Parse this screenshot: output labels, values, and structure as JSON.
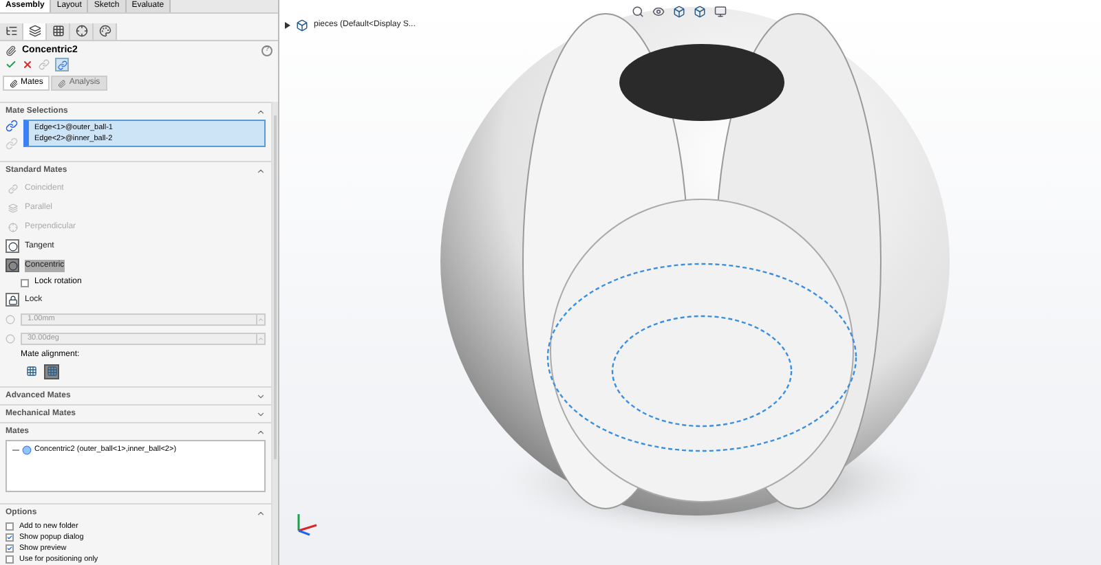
{
  "command_tabs": [
    {
      "label": "Assembly",
      "selected": true
    },
    {
      "label": "Layout",
      "selected": false
    },
    {
      "label": "Sketch",
      "selected": false
    },
    {
      "label": "Evaluate",
      "selected": false
    }
  ],
  "manager_tabs": [
    {
      "selected": false
    },
    {
      "selected": true
    },
    {
      "selected": false
    },
    {
      "selected": false
    },
    {
      "selected": false
    }
  ],
  "feature_title": "Concentric2",
  "help_icon": "?",
  "panel_tabs": [
    {
      "label": "Mates",
      "selected": true
    },
    {
      "label": "Analysis",
      "selected": false
    }
  ],
  "mate_selections": {
    "title": "Mate Selections",
    "items": [
      "Edge<1>@outer_ball-1",
      "Edge<2>@inner_ball-2"
    ]
  },
  "standard_mates": {
    "title": "Standard Mates",
    "items": [
      {
        "kind": "mate",
        "label": "Coincident",
        "selected": false,
        "disabled": true
      },
      {
        "kind": "mate",
        "label": "Parallel",
        "selected": false,
        "disabled": true
      },
      {
        "kind": "mate",
        "label": "Perpendicular",
        "selected": false,
        "disabled": true
      },
      {
        "kind": "mate",
        "label": "Tangent",
        "selected": false,
        "disabled": false
      },
      {
        "kind": "mate",
        "label": "Concentric",
        "selected": true,
        "disabled": false
      },
      {
        "kind": "checkbox",
        "label": "Lock rotation",
        "checked": false
      },
      {
        "kind": "mate",
        "label": "Lock",
        "selected": false,
        "disabled": false
      },
      {
        "kind": "field",
        "value": "1.00mm"
      },
      {
        "kind": "field",
        "value": "30.00deg"
      }
    ]
  },
  "mate_alignment": {
    "label": "Mate alignment:",
    "options": [
      {
        "selected": false
      },
      {
        "selected": true
      }
    ]
  },
  "sections": [
    {
      "title": "Advanced Mates",
      "expanded": false
    },
    {
      "title": "Mechanical Mates",
      "expanded": false
    },
    {
      "title": "Mates",
      "expanded": true,
      "items": [
        "Concentric2 (outer_ball<1>,inner_ball<2>)"
      ]
    }
  ],
  "options": {
    "title": "Options",
    "items": [
      {
        "label": "Add to new folder",
        "checked": false
      },
      {
        "label": "Show popup dialog",
        "checked": true
      },
      {
        "label": "Show preview",
        "checked": true
      },
      {
        "label": "Use for positioning only",
        "checked": false
      }
    ]
  },
  "tree": {
    "label": "pieces (Default<Display S..."
  }
}
